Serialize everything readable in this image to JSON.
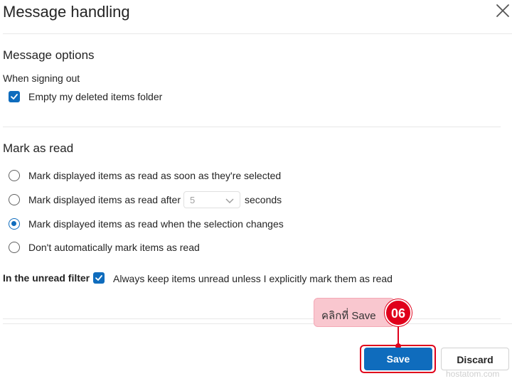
{
  "dialog": {
    "title": "Message handling"
  },
  "message_options": {
    "title": "Message options",
    "signout_label": "When signing out",
    "empty_deleted": {
      "label": "Empty my deleted items folder",
      "checked": true
    }
  },
  "mark_as_read": {
    "title": "Mark as read",
    "options": [
      {
        "label": "Mark displayed items as read as soon as they're selected",
        "checked": false
      },
      {
        "label": "Mark displayed items as read after",
        "checked": false,
        "delay_value": "5",
        "suffix": "seconds"
      },
      {
        "label": "Mark displayed items as read when the selection changes",
        "checked": true
      },
      {
        "label": "Don't automatically mark items as read",
        "checked": false
      }
    ]
  },
  "unread_filter": {
    "label": "In the unread filter",
    "option": {
      "label": "Always keep items unread unless I explicitly mark them as read",
      "checked": true
    }
  },
  "annotation": {
    "callout_text": "คลิกที่  Save",
    "step_number": "06",
    "color": "#e0001b"
  },
  "footer": {
    "save_label": "Save",
    "discard_label": "Discard",
    "accent_color": "#0f6cbd"
  },
  "watermark": "hostatom.com"
}
